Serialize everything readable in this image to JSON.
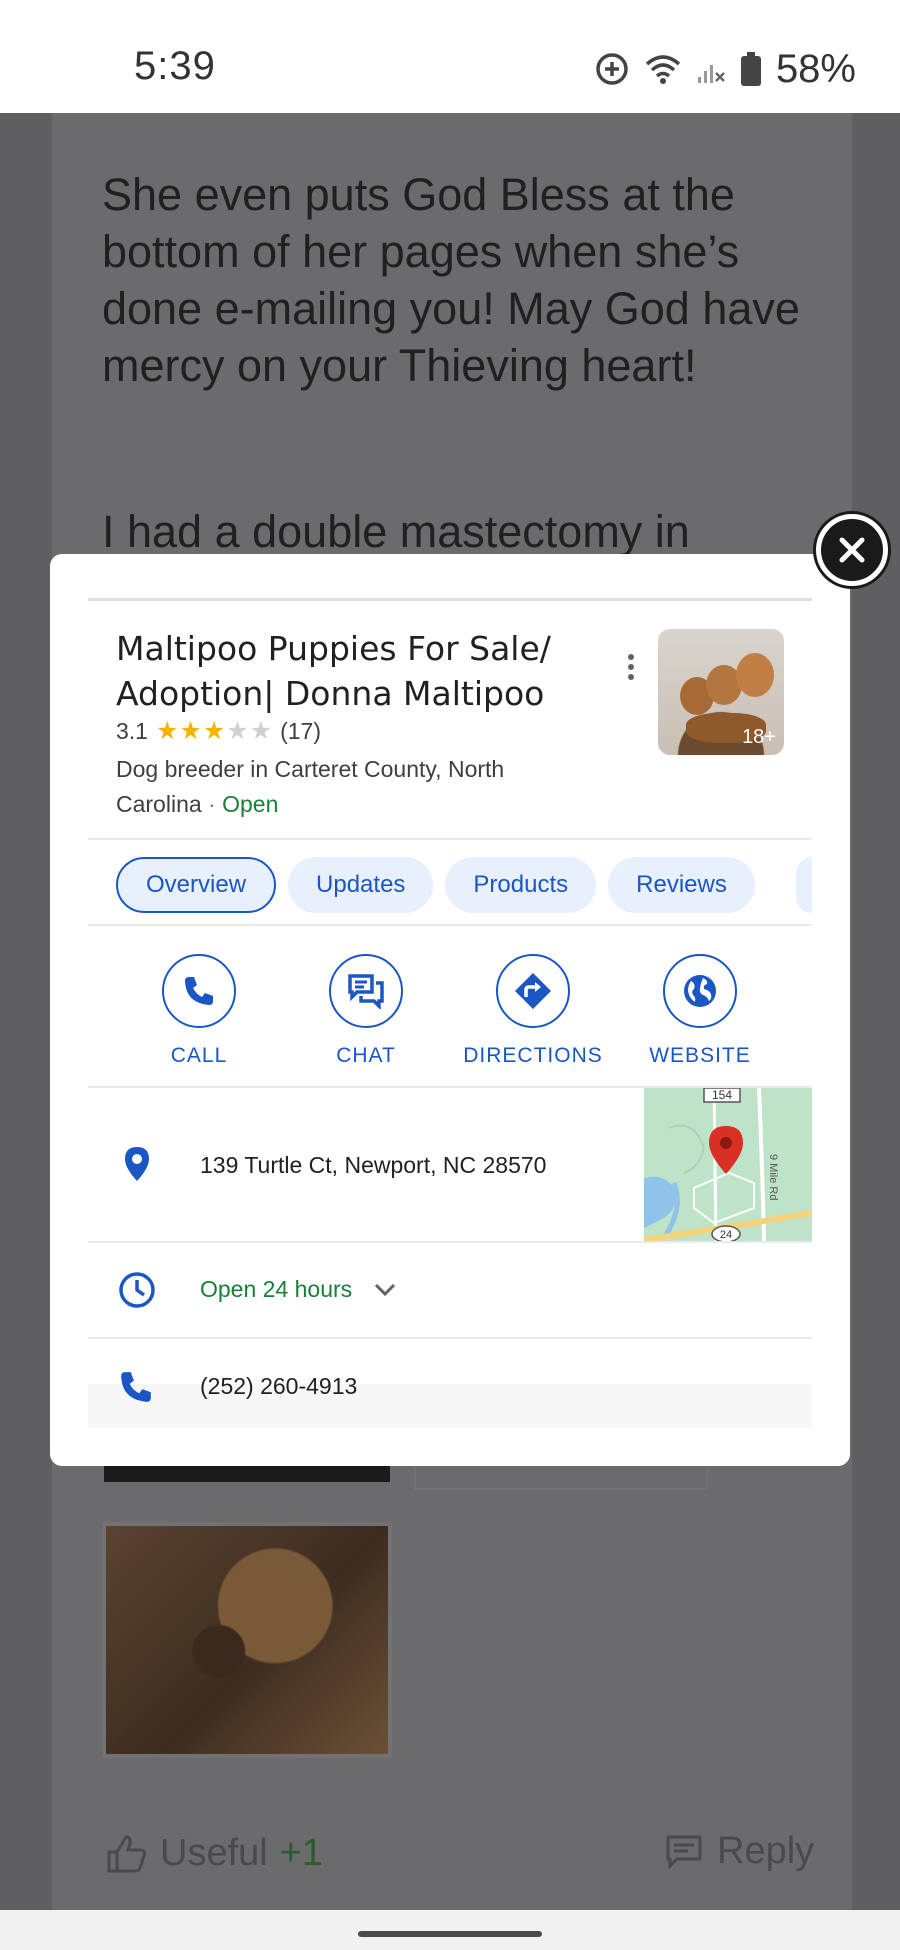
{
  "status_bar": {
    "time": "5:39",
    "battery": "58%"
  },
  "background": {
    "paragraph_1": "She even puts God Bless at the bottom of her pages when she’s done e-mailing you! May God have mercy on your Thieving heart!",
    "paragraph_2": "I had a double mastectomy in",
    "useful_label": "Useful",
    "useful_count": "+1",
    "reply_label": "Reply"
  },
  "popup": {
    "title": "Maltipoo Puppies For Sale/ Adoption| Donna Maltipoo",
    "rating": "3.1",
    "rating_value": 3.1,
    "review_count": "(17)",
    "description": "Dog breeder in Carteret County, North Carolina",
    "separator": "·",
    "open_status": "Open",
    "photo_count": "18+",
    "tabs": [
      {
        "label": "Overview",
        "active": true
      },
      {
        "label": "Updates",
        "active": false
      },
      {
        "label": "Products",
        "active": false
      },
      {
        "label": "Reviews",
        "active": false
      }
    ],
    "actions": [
      {
        "label": "CALL",
        "icon": "phone-icon"
      },
      {
        "label": "CHAT",
        "icon": "chat-icon"
      },
      {
        "label": "DIRECTIONS",
        "icon": "directions-icon"
      },
      {
        "label": "WEBSITE",
        "icon": "globe-icon"
      }
    ],
    "address": "139 Turtle Ct, Newport, NC 28570",
    "hours": "Open 24 hours",
    "phone": "(252) 260-4913",
    "map": {
      "road_label_1": "154",
      "road_label_2": "24",
      "road_label_3": "9 Mile Rd"
    }
  },
  "colors": {
    "accent": "#1a56c4",
    "open_green": "#188038",
    "star": "#f4b400",
    "map_pin": "#d93025"
  }
}
